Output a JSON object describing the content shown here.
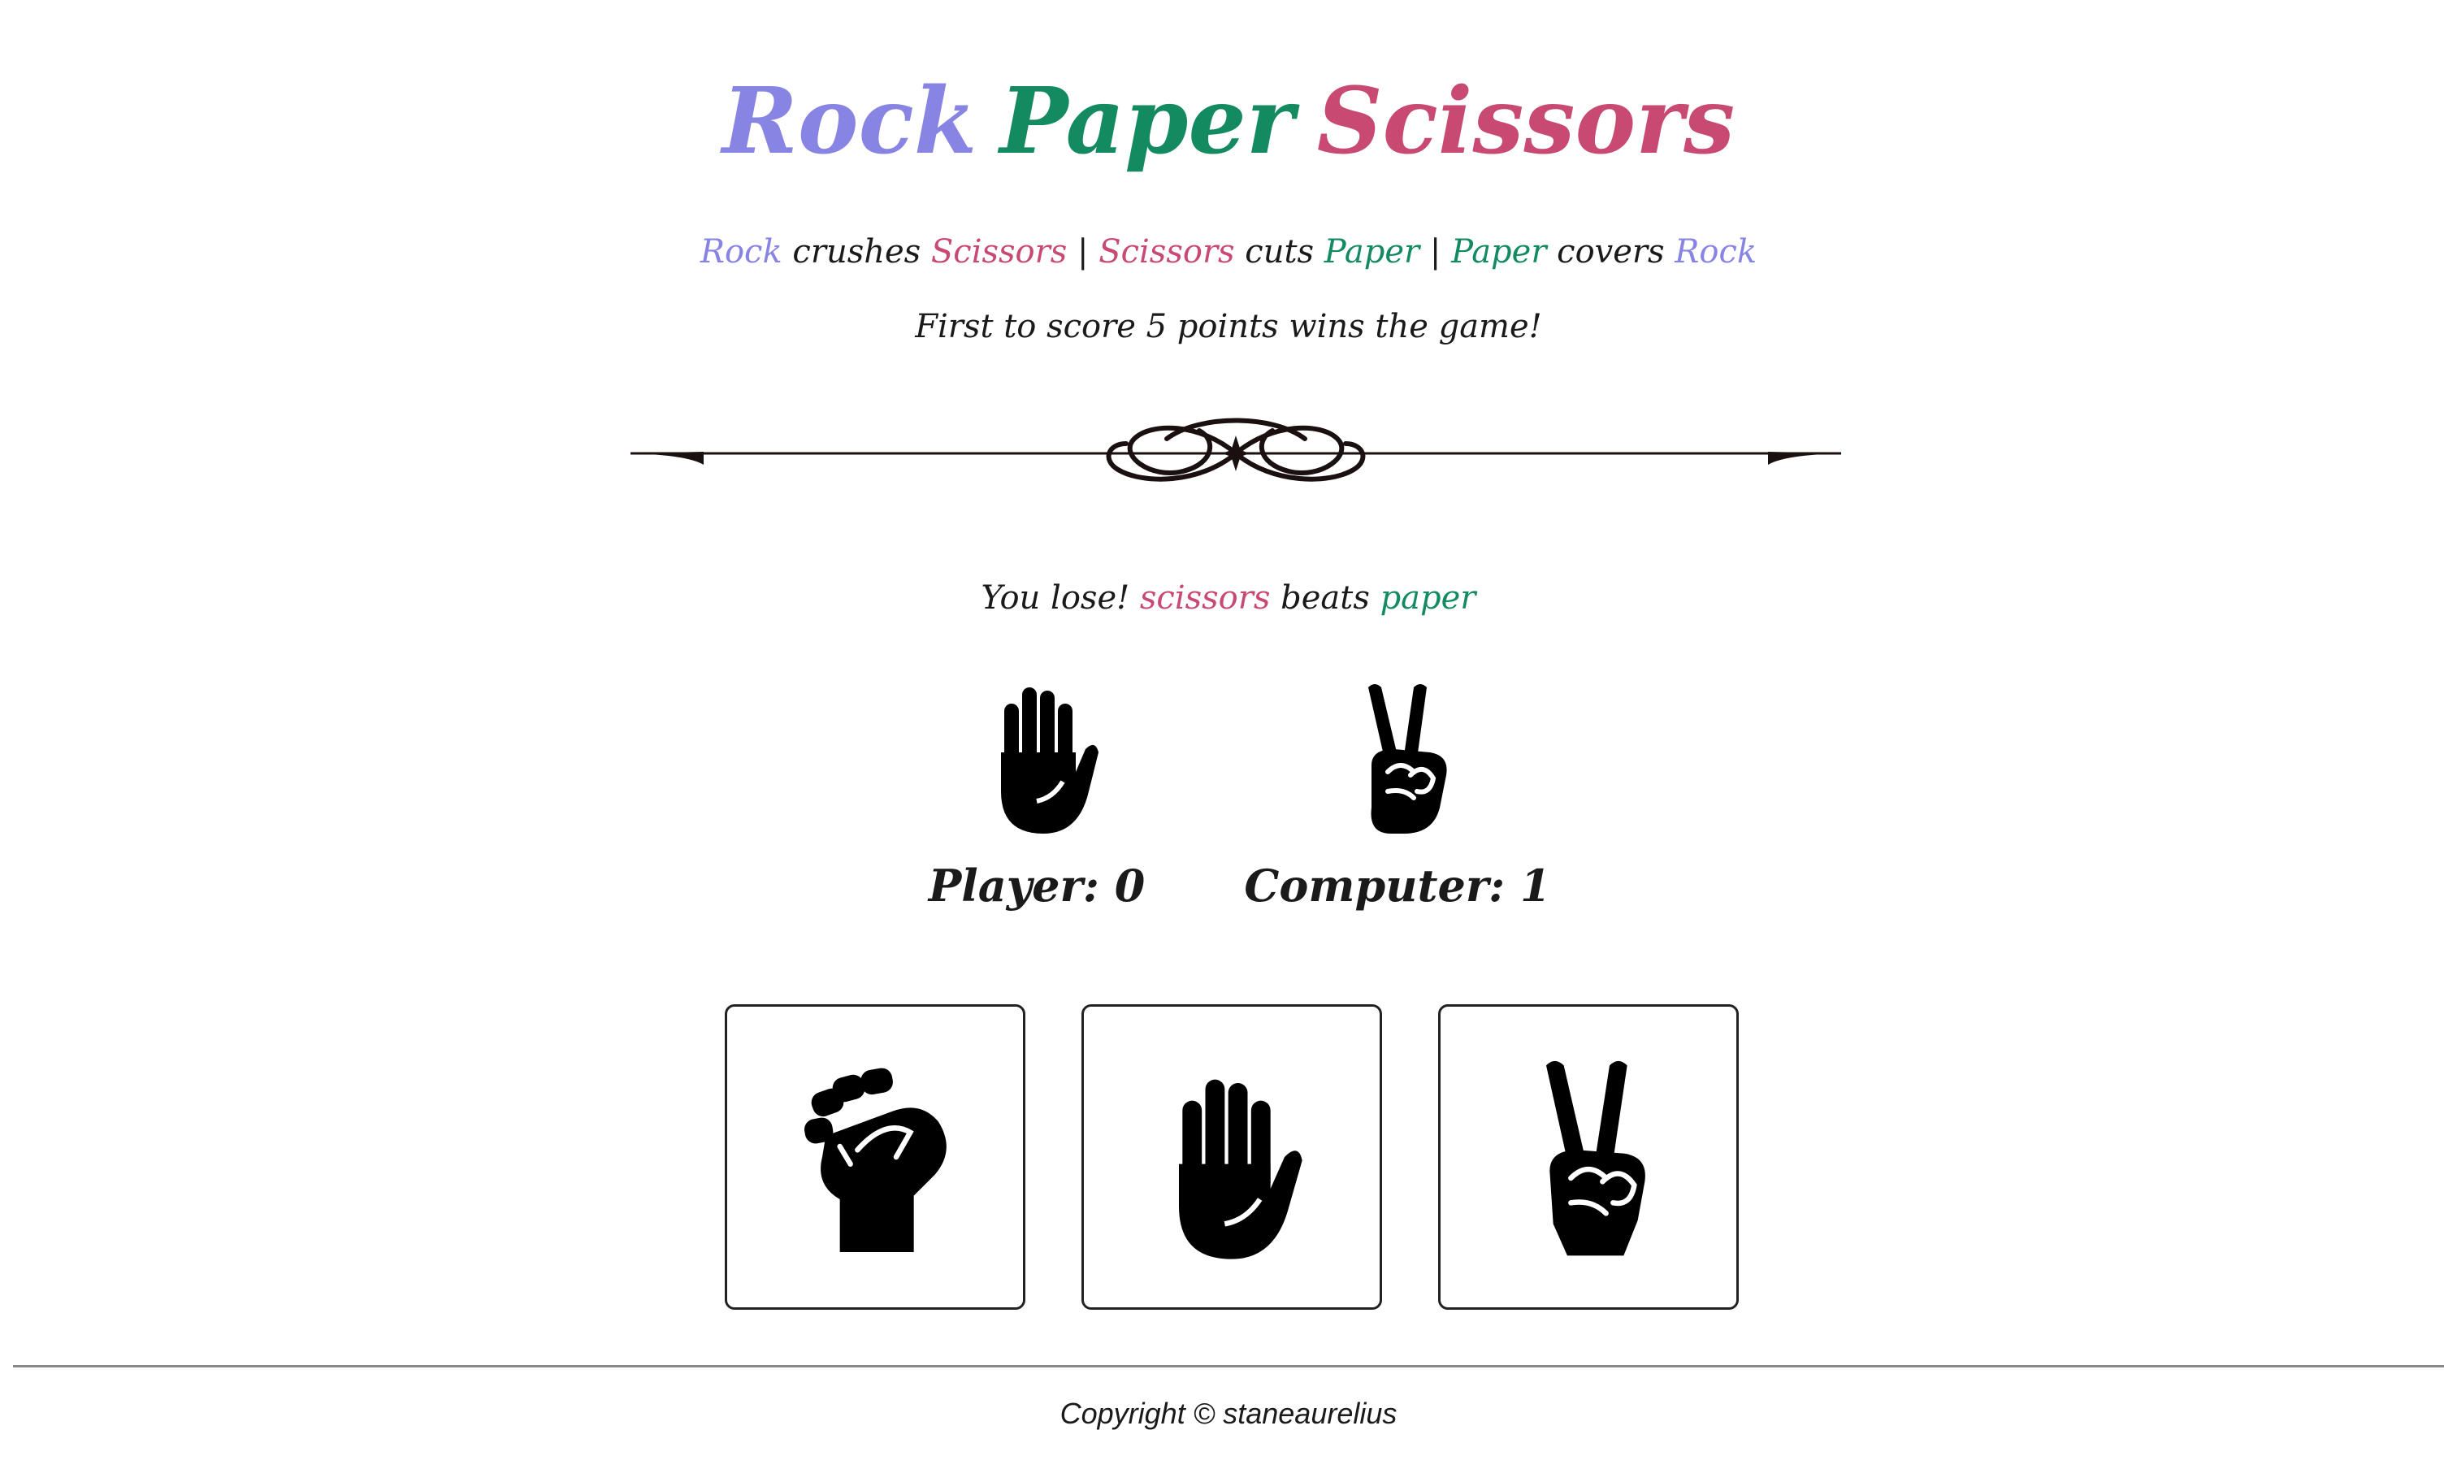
{
  "title": {
    "rock": "Rock",
    "paper": "Paper",
    "scissors": "Scissors"
  },
  "rules": {
    "r1_a": "Rock",
    "r1_verb": " crushes ",
    "r1_b": "Scissors",
    "sep1": " | ",
    "r2_a": "Scissors",
    "r2_verb": " cuts ",
    "r2_b": "Paper",
    "sep2": " | ",
    "r3_a": "Paper",
    "r3_verb": " covers ",
    "r3_b": "Rock"
  },
  "goal": "First to score 5 points wins the game!",
  "result": {
    "prefix": "You lose! ",
    "winner": "scissors",
    "verb": " beats ",
    "loser": "paper"
  },
  "round": {
    "player_hand": "paper-hand-icon",
    "computer_hand": "scissors-hand-icon"
  },
  "scores": {
    "player": "Player: 0",
    "computer": "Computer: 1"
  },
  "choices": [
    {
      "name": "rock",
      "icon": "rock-fist-icon"
    },
    {
      "name": "paper",
      "icon": "paper-hand-icon"
    },
    {
      "name": "scissors",
      "icon": "scissors-hand-icon"
    }
  ],
  "colors": {
    "rock": "#8884e3",
    "paper": "#138a60",
    "scissors": "#c84a72",
    "text": "#1a1a1a"
  },
  "footer": "Copyright © staneaurelius"
}
